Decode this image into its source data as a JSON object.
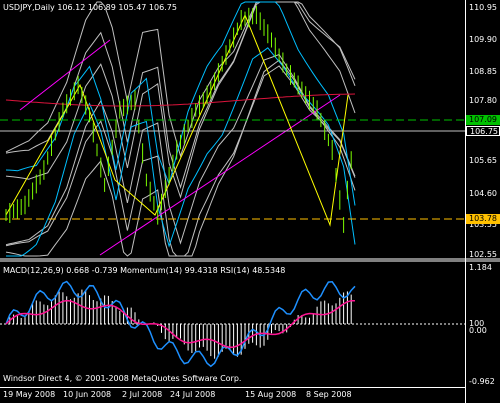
{
  "main": {
    "title": "USDJPY,Daily  106.12 106.89 105.47 106.75",
    "price_scale": [
      "110.95",
      "109.90",
      "108.85",
      "107.80",
      "106.75",
      "105.65",
      "104.60",
      "103.55",
      "102.55"
    ],
    "tags": [
      {
        "text": "107.09",
        "color": "#00c000",
        "text_color": "#000"
      },
      {
        "text": "103.78",
        "color": "#ffc000",
        "text_color": "#000"
      }
    ],
    "last_price": "106.75"
  },
  "sub": {
    "title": "MACD(12,26,9) 0.668 -0.739  Momentum(14) 99.4318  RSI(14) 48.5348",
    "scale": [
      "1.184",
      "100",
      "0.00",
      "-0.962"
    ]
  },
  "footer": {
    "text": "Windsor Direct 4, © 2001-2008 MetaQuotes Software Corp."
  },
  "dates": [
    "19 May 2008",
    "10 Jun 2008",
    "2 Jul 2008",
    "24 Jul 2008",
    "15 Aug 2008",
    "8 Sep 2008"
  ],
  "colors": {
    "bars": "#7cfc00",
    "envelope": "#c0c0c0",
    "bollinger": "#00bfff",
    "ma": "#dc143c",
    "zigzag": "#ffff00",
    "trend": "#ff00ff",
    "macd": "#1e90ff",
    "signal": "#ff1493",
    "histogram": "#ffffff"
  }
}
